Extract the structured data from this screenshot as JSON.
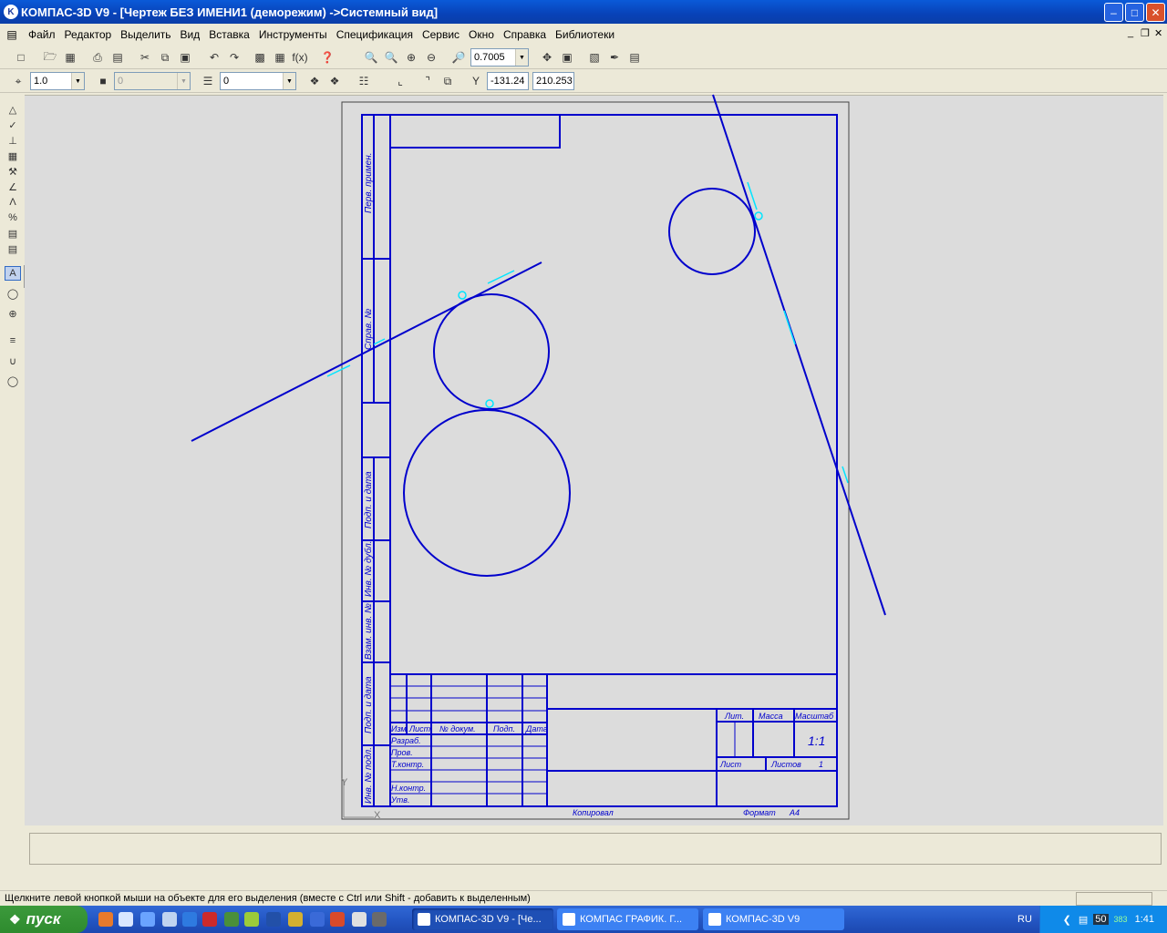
{
  "window": {
    "title": "КОМПАС-3D V9 - [Чертеж БЕЗ ИМЕНИ1 (деморежим) ->Системный вид]"
  },
  "menu": [
    "Файл",
    "Редактор",
    "Выделить",
    "Вид",
    "Вставка",
    "Инструменты",
    "Спецификация",
    "Сервис",
    "Окно",
    "Справка",
    "Библиотеки"
  ],
  "toolbar1": {
    "zoom_value": "0.7005"
  },
  "toolbar2": {
    "step_value": "1.0",
    "angle_value": "0",
    "layer_value": "0",
    "coord_x": "-131.24",
    "coord_y": "210.253"
  },
  "drawing": {
    "side_labels": [
      "Перв. примен.",
      "Справ. №",
      "Подп. и дата",
      "Инв. № дубл.",
      "Взам. инв. №",
      "Подп. и дата",
      "Инв. № подл."
    ],
    "stamp_headers": [
      "Изм.",
      "Лист",
      "№ докум.",
      "Подп.",
      "Дата"
    ],
    "stamp_rows": [
      "Разраб.",
      "Пров.",
      "Т.контр.",
      "Н.контр.",
      "Утв."
    ],
    "stamp_right": {
      "lit": "Лит.",
      "mass": "Масса",
      "scale": "Масштаб",
      "scale_value": "1:1",
      "sheet": "Лист",
      "sheets": "Листов",
      "sheets_value": "1"
    },
    "copied": "Копировал",
    "format": "Формат",
    "format_value": "А4",
    "axis_y": "Y",
    "axis_x": "X"
  },
  "status": {
    "message": "Щелкните левой кнопкой мыши на объекте для его выделения (вместе с Ctrl или Shift - добавить к выделенным)"
  },
  "taskbar": {
    "start": "пуск",
    "tasks": [
      "КОМПАС-3D V9 - [Че...",
      "КОМПАС ГРАФИК. Г...",
      "КОМПАС-3D V9"
    ],
    "lang": "RU",
    "tray_badge_1": "50",
    "tray_badge_2": "383",
    "clock": "1:41"
  }
}
